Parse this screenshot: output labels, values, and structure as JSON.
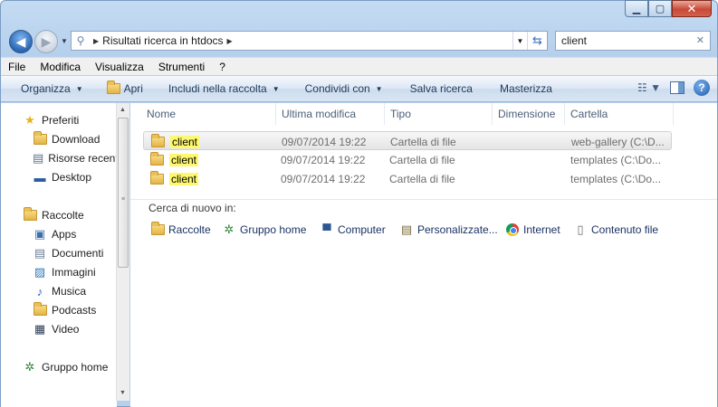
{
  "window": {
    "minimize_label": "▁",
    "maximize_label": "▢",
    "close_label": "✕"
  },
  "address_bar": {
    "crumb": "Risultati ricerca in htdocs"
  },
  "search": {
    "value": "client",
    "clear_label": "✕"
  },
  "menu": [
    "File",
    "Modifica",
    "Visualizza",
    "Strumenti",
    "?"
  ],
  "commands": {
    "organize": "Organizza",
    "open": "Apri",
    "include": "Includi nella raccolta",
    "share": "Condividi con",
    "save_search": "Salva ricerca",
    "burn": "Masterizza"
  },
  "nav": {
    "favorites": {
      "label": "Preferiti",
      "items": [
        "Download",
        "Risorse recenti",
        "Desktop"
      ]
    },
    "libraries": {
      "label": "Raccolte",
      "items": [
        "Apps",
        "Documenti",
        "Immagini",
        "Musica",
        "Podcasts",
        "Video"
      ]
    },
    "homegroup": "Gruppo home"
  },
  "columns": [
    "Nome",
    "Ultima modifica",
    "Tipo",
    "Dimensione",
    "Cartella"
  ],
  "rows": [
    {
      "name": "client",
      "modified": "09/07/2014 19:22",
      "type": "Cartella di file",
      "size": "",
      "folder": "web-gallery (C:\\D..."
    },
    {
      "name": "client",
      "modified": "09/07/2014 19:22",
      "type": "Cartella di file",
      "size": "",
      "folder": "templates (C:\\Do..."
    },
    {
      "name": "client",
      "modified": "09/07/2014 19:22",
      "type": "Cartella di file",
      "size": "",
      "folder": "templates (C:\\Do..."
    }
  ],
  "search_again": {
    "label": "Cerca di nuovo in:",
    "targets": [
      "Raccolte",
      "Gruppo home",
      "Computer",
      "Personalizzate...",
      "Internet",
      "Contenuto file"
    ]
  },
  "colors": {
    "highlight": "#fdf86e",
    "accent": "#1e395b",
    "close": "#c74a38"
  }
}
